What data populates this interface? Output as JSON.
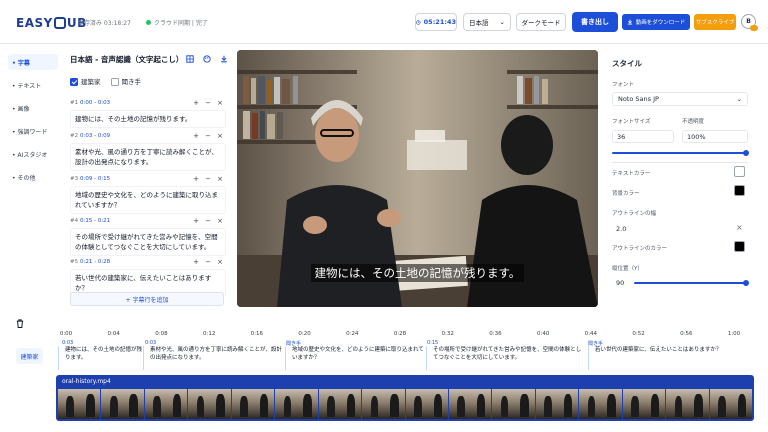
{
  "header": {
    "logo_left": "EASY",
    "logo_right": "UB",
    "saved": "保存済み 03:18:27",
    "sync": "クラウド同期 | 完了",
    "timer": "05:21:43",
    "language": "日本語",
    "dark_mode": "ダークモード",
    "export": "書き出し",
    "download": "動画をダウンロード",
    "subscribe": "サブスクライブ",
    "avatar": "B"
  },
  "nav": [
    {
      "label": "• 字幕"
    },
    {
      "label": "• テキスト"
    },
    {
      "label": "• 画像"
    },
    {
      "label": "• 強調ワード"
    },
    {
      "label": "• AIスタジオ"
    },
    {
      "label": "• その他"
    }
  ],
  "panel": {
    "title": "日本語 - 音声認識（文字起こし）",
    "speakers": [
      "建築家",
      "聞き手"
    ],
    "entries": [
      {
        "num": "#1",
        "range": "0:00 - 0:03",
        "text": "建物には、その土地の記憶が残ります。"
      },
      {
        "num": "#2",
        "range": "0:03 - 0:09",
        "text": "素材や光、風の通り方を丁寧に読み解くことが、設計の出発点になります。"
      },
      {
        "num": "#3",
        "range": "0:09 - 0:15",
        "text": "地域の歴史や文化を、どのように建築に取り込まれていますか？"
      },
      {
        "num": "#4",
        "range": "0:15 - 0:21",
        "text": "その場所で受け継がれてきた営みや記憶を、空間の体験としてつなぐことを大切にしています。"
      },
      {
        "num": "#5",
        "range": "0:21 - 0:28",
        "text": "若い世代の建築家に、伝えたいことはありますか？"
      }
    ],
    "add_row": "+ 字幕行を追加"
  },
  "video": {
    "caption": "建物には、その土地の記憶が残ります。"
  },
  "style": {
    "title": "スタイル",
    "font_label": "フォント",
    "font_value": "Noto Sans JP",
    "font_size_label": "フォントサイズ",
    "opacity_label": "不透明度",
    "font_size_value": "36",
    "opacity_value": "100%",
    "text_color_label": "テキストカラー",
    "bg_color_label": "背景カラー",
    "outline_width_label": "アウトラインの幅",
    "outline_width_value": "2.0",
    "outline_color_label": "アウトラインのカラー",
    "vpos_label": "縦位置（Y）",
    "vpos_value": "90",
    "text_color": "#ffffff",
    "bg_color": "#000000",
    "outline_color": "#000000"
  },
  "timeline": {
    "ticks": [
      "0:00",
      "0:04",
      "0:08",
      "0:12",
      "0:16",
      "0:20",
      "0:24",
      "0:28",
      "0:32",
      "0:36",
      "0:40",
      "0:44",
      "0:52",
      "0:56",
      "1:00"
    ],
    "track_label": "建築家",
    "markers": [
      "0:03",
      "聞き手",
      "0:15",
      "聞き手"
    ],
    "segments": [
      "建物には、その土地の記憶が残ります。",
      "素材や光、風の通り方を丁寧に読み解くことが、設計の出発点になります。",
      "地域の歴史や文化を、どのように建築に取り込まれていますか？",
      "その場所で受け継がれてきた営みや記憶を、空間の体験としてつなぐことを大切にしています。",
      "若い世代の建築家に、伝えたいことはありますか？"
    ],
    "clip_name": "oral-history.mp4"
  },
  "colors": {
    "accent": "#1d4ed8",
    "subscribe": "#f59e0b"
  }
}
